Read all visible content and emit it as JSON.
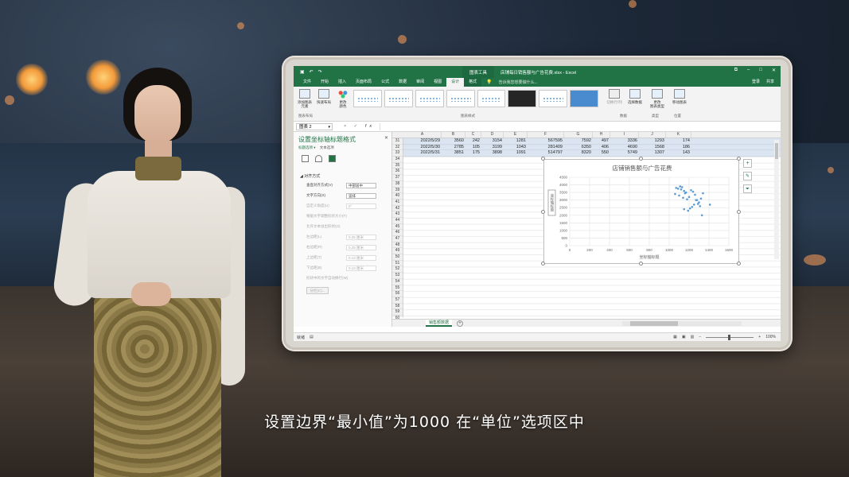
{
  "excel": {
    "qat_icons": [
      "save-icon",
      "undo-icon",
      "redo-icon"
    ],
    "context_tab_group": "图表工具",
    "doc_title": "店铺每日销售额与广告花费.xlsx - Excel",
    "tabs": [
      "文件",
      "开始",
      "插入",
      "页面布局",
      "公式",
      "数据",
      "审阅",
      "视图",
      "设计",
      "格式"
    ],
    "active_tab": "设计",
    "tell_me": "告诉我您想要做什么...",
    "user": "登录",
    "share": "共享",
    "ribbon": {
      "add_element": "添加图表\n元素",
      "quick_layout": "快速布局",
      "change_colors": "更改\n颜色",
      "switch_row_col": "切换行/列",
      "select_data": "选择数据",
      "change_chart_type": "更改\n图表类型",
      "move_chart": "移动图表",
      "group_layouts": "图表布局",
      "group_styles": "图表样式",
      "group_data": "数据",
      "group_type": "类型",
      "group_location": "位置"
    },
    "name_box": "图表 2",
    "formula_icons": [
      "×",
      "✓",
      "fx"
    ]
  },
  "pane": {
    "title": "设置坐标轴标题格式",
    "subtitle_a": "标题选项",
    "subtitle_b": "文本选项",
    "section": "对齐方式",
    "rows": [
      {
        "label": "垂直对齐方式(V)",
        "value": "中部居中"
      },
      {
        "label": "文字方向(X)",
        "value": "竖排"
      },
      {
        "label": "自定义角度(U)",
        "value": "0°"
      },
      {
        "label": "根据文字调整形状大小(F)",
        "value": ""
      },
      {
        "label": "允许文本溢出形状(O)",
        "value": ""
      },
      {
        "label": "左边距(L)",
        "value": "0.25 厘米"
      },
      {
        "label": "右边距(R)",
        "value": "0.25 厘米"
      },
      {
        "label": "上边距(T)",
        "value": "0.13 厘米"
      },
      {
        "label": "下边距(B)",
        "value": "0.13 厘米"
      },
      {
        "label": "形状中的文字自动换行(W)",
        "value": ""
      }
    ],
    "button": "分栏(C)..."
  },
  "grid": {
    "columns": [
      "A",
      "B",
      "C",
      "D",
      "E",
      "F",
      "G",
      "H",
      "I",
      "J",
      "K"
    ],
    "row_numbers": [
      31,
      32,
      33,
      34,
      35,
      36,
      37,
      38,
      39,
      40,
      41,
      42,
      43,
      44,
      45,
      46,
      47,
      48,
      49,
      50,
      51,
      52,
      53,
      54,
      55,
      56,
      57,
      58,
      59,
      60
    ],
    "rows": [
      [
        "2022/5/29",
        "3560",
        "242",
        "3154",
        "1281",
        "567595",
        "7592",
        "497",
        "3336",
        "1293",
        "174"
      ],
      [
        "2022/5/30",
        "2785",
        "105",
        "3199",
        "1043",
        "281409",
        "6350",
        "406",
        "4690",
        "1568",
        "186"
      ],
      [
        "2022/5/31",
        "3851",
        "175",
        "3898",
        "1091",
        "514797",
        "8320",
        "550",
        "5749",
        "1307",
        "143"
      ]
    ],
    "sheet_tab": "销售额数据",
    "status_left": "就绪",
    "zoom": "100%"
  },
  "chart_data": {
    "type": "scatter",
    "title": "店铺销售额与广告花费",
    "xlabel": "坐标轴标题",
    "ylabel": "坐标轴标题",
    "x_ticks": [
      0,
      200,
      400,
      600,
      800,
      1000,
      1200,
      1400,
      1600
    ],
    "y_ticks": [
      0,
      500,
      1000,
      1500,
      2000,
      2500,
      3000,
      3500,
      4000,
      4500
    ],
    "xlim": [
      0,
      1600
    ],
    "ylim": [
      0,
      4500
    ],
    "series": [
      {
        "x": [
          1070,
          1090,
          1110,
          1130,
          1150,
          1170,
          1100,
          1120,
          1160,
          1060,
          1180,
          1200,
          1220,
          1240,
          1260,
          1280,
          1300,
          1320,
          1340,
          1210,
          1230,
          1250,
          1270,
          1150,
          1190,
          1290,
          1310,
          1410,
          1330,
          1140
        ],
        "y": [
          3800,
          3750,
          3900,
          3850,
          3600,
          3500,
          3300,
          3700,
          3450,
          3400,
          3050,
          3200,
          3650,
          3550,
          3350,
          3000,
          2850,
          3100,
          3450,
          2450,
          2550,
          2700,
          3000,
          2400,
          2300,
          2750,
          2600,
          2700,
          2000,
          3150
        ]
      }
    ],
    "grid": true,
    "color": "#5b9bd5"
  },
  "subtitle": "设置边界“最小值”为1000 在“单位”选项区中"
}
